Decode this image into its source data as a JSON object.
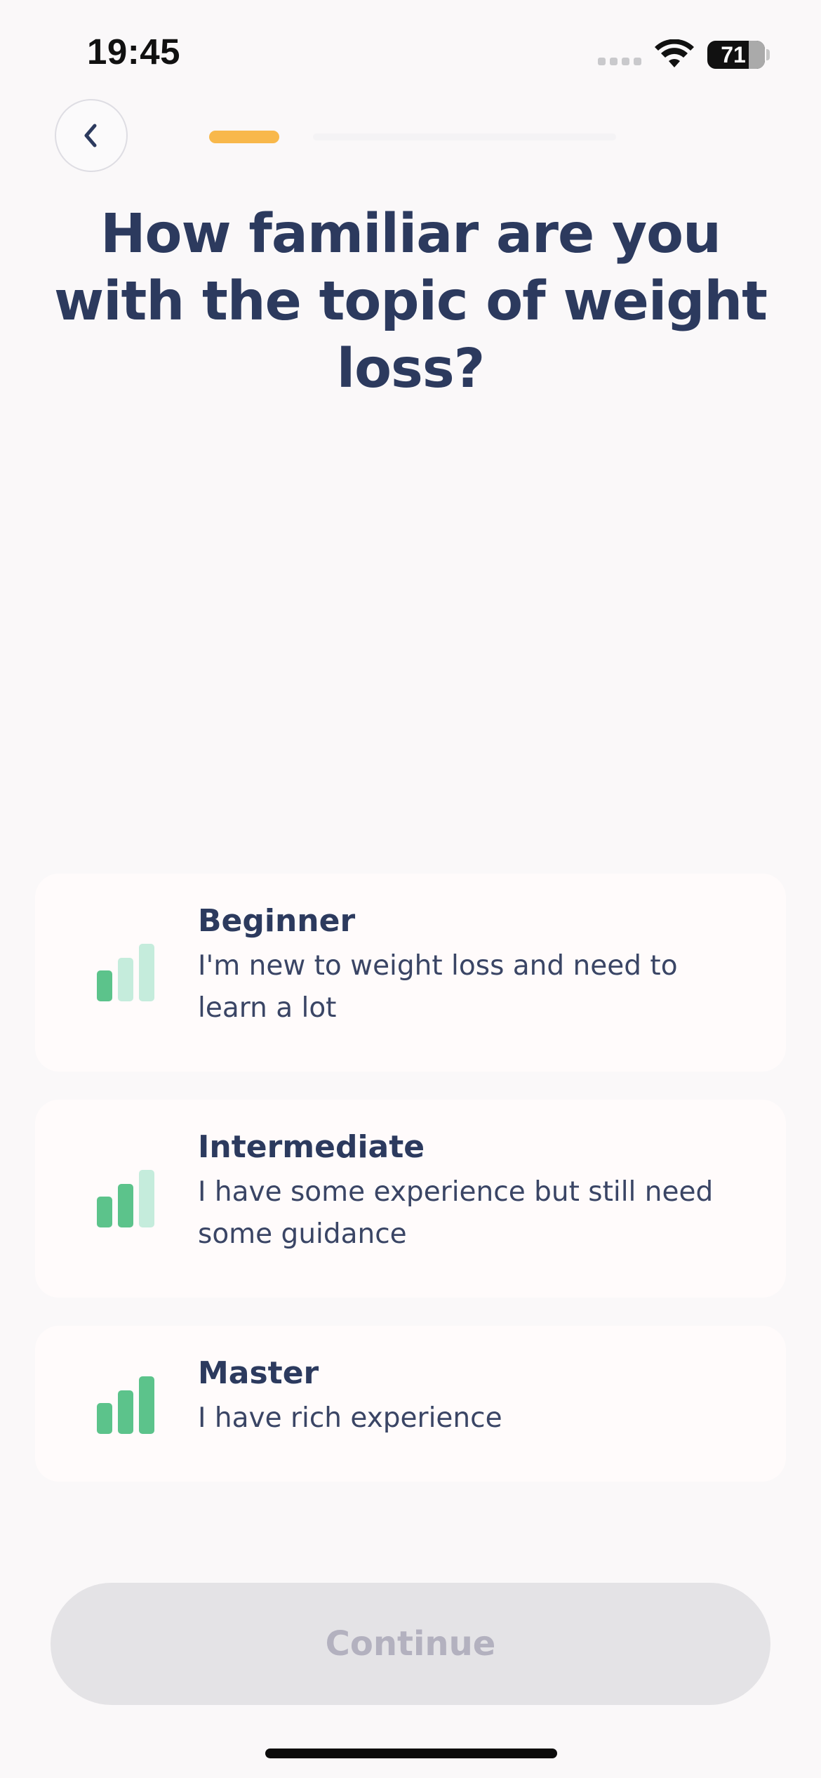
{
  "status_bar": {
    "time": "19:45",
    "battery_percent": "71"
  },
  "navigation": {
    "back_icon": "chevron-left-icon",
    "progress_fraction": 0.1
  },
  "question": {
    "title": "How familiar are you with the topic of weight loss?"
  },
  "options": [
    {
      "title": "Beginner",
      "description": "I'm new to weight loss and need to learn a lot",
      "icon": "level-bars-icon",
      "level": 1
    },
    {
      "title": "Intermediate",
      "description": "I have some experience but still need some guidance",
      "icon": "level-bars-icon",
      "level": 2
    },
    {
      "title": "Master",
      "description": "I have rich experience",
      "icon": "level-bars-icon",
      "level": 3
    }
  ],
  "continue_button": {
    "label": "Continue"
  },
  "colors": {
    "title_text": "#2c3a5e",
    "progress_accent": "#f8b84b",
    "bar_active": "#5cc38b",
    "bar_inactive": "#c5ecdc",
    "button_disabled_bg": "#e4e3e6",
    "button_disabled_text": "#b3b1bf"
  }
}
